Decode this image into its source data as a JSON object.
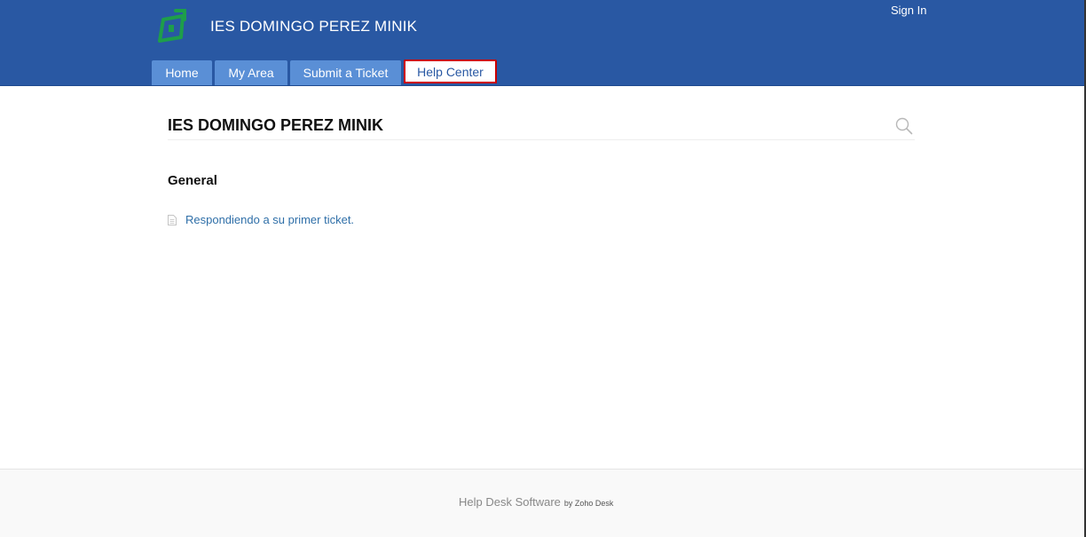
{
  "header": {
    "site_title": "IES DOMINGO PEREZ MINIK",
    "sign_in": "Sign In",
    "logo_icon": "helpdesk-logo-icon",
    "background_color": "#2958a3",
    "tabs": [
      {
        "label": "Home",
        "active": false
      },
      {
        "label": "My Area",
        "active": false
      },
      {
        "label": "Submit a Ticket",
        "active": false
      },
      {
        "label": "Help Center",
        "active": true
      }
    ]
  },
  "main": {
    "title": "IES DOMINGO PEREZ MINIK",
    "search_icon": "search-icon",
    "section": {
      "title": "General",
      "articles": [
        {
          "icon": "document-icon",
          "title": "Respondiendo a su primer ticket."
        }
      ]
    }
  },
  "footer": {
    "text": "Help Desk Software",
    "by_text": "by Zoho Desk"
  },
  "colors": {
    "accent": "#2958a3",
    "tab": "#5a8fd6",
    "active_tab_border": "#cc0000",
    "link": "#2f6fa8",
    "logo": "#1e9e4a"
  }
}
